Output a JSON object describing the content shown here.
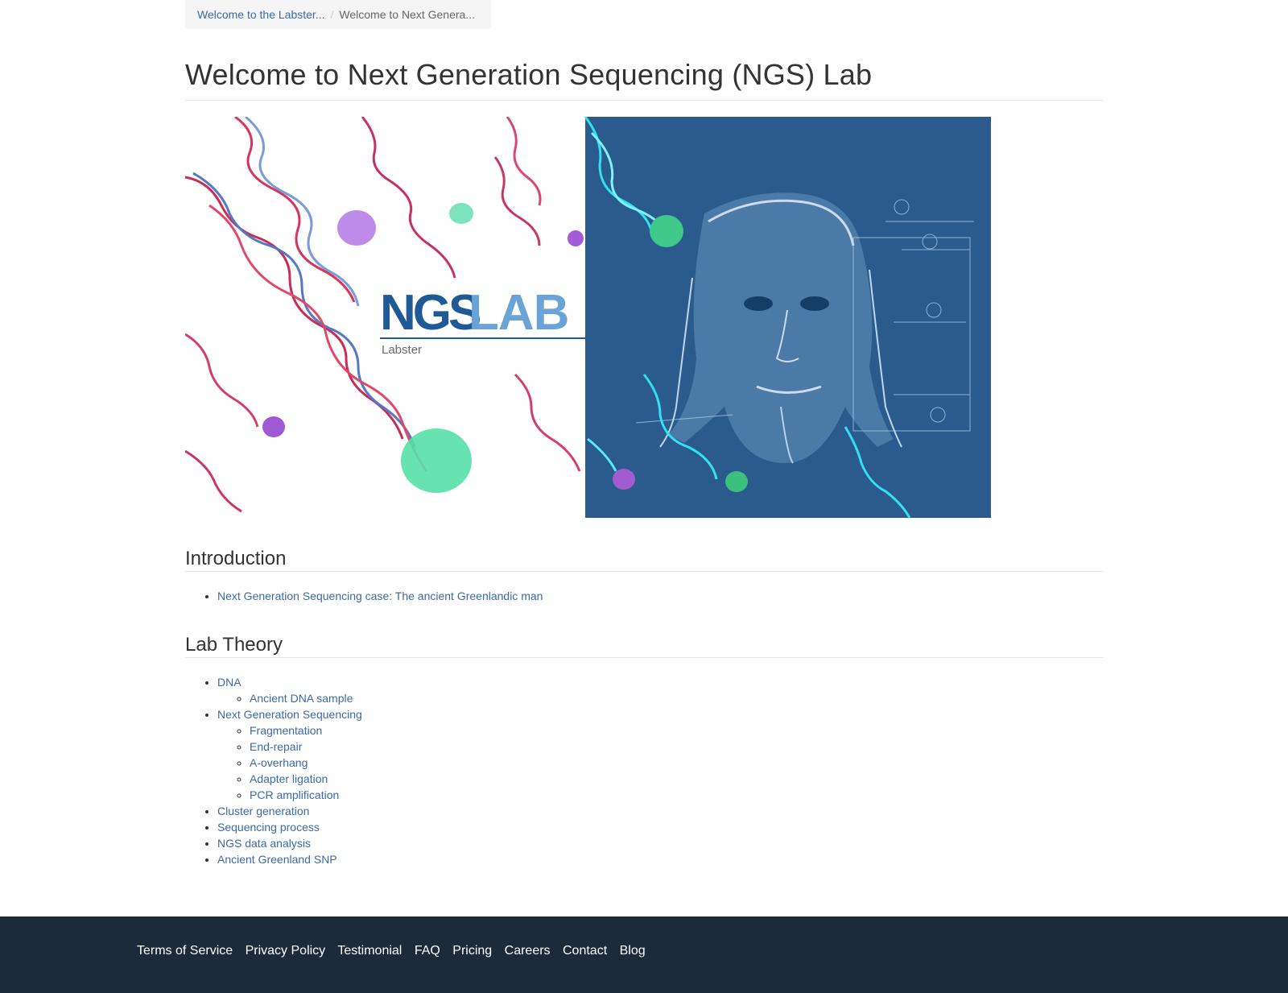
{
  "breadcrumb": {
    "items": [
      {
        "label": "Welcome to the Labster..."
      },
      {
        "label": "Welcome to Next Genera..."
      }
    ],
    "separator": "/"
  },
  "page": {
    "title": "Welcome to Next Generation Sequencing (NGS) Lab"
  },
  "banner": {
    "logo_ngs": "NGS",
    "logo_lab": "LAB",
    "logo_sub": "Labster",
    "left_bg": "#ffffff",
    "right_bg": "#2a5b8c"
  },
  "introduction": {
    "heading": "Introduction",
    "items": [
      {
        "label": "Next Generation Sequencing case: The ancient Greenlandic man"
      }
    ]
  },
  "lab_theory": {
    "heading": "Lab Theory",
    "items": [
      {
        "label": "DNA",
        "children": [
          {
            "label": "Ancient DNA sample"
          }
        ]
      },
      {
        "label": "Next Generation Sequencing",
        "children": [
          {
            "label": "Fragmentation"
          },
          {
            "label": "End-repair"
          },
          {
            "label": "A-overhang"
          },
          {
            "label": "Adapter ligation"
          },
          {
            "label": "PCR amplification"
          }
        ]
      },
      {
        "label": "Cluster generation"
      },
      {
        "label": "Sequencing process"
      },
      {
        "label": "NGS data analysis"
      },
      {
        "label": "Ancient Greenland SNP"
      }
    ]
  },
  "footer": {
    "links": [
      {
        "label": "Terms of Service"
      },
      {
        "label": "Privacy Policy"
      },
      {
        "label": "Testimonial"
      },
      {
        "label": "FAQ"
      },
      {
        "label": "Pricing"
      },
      {
        "label": "Careers"
      },
      {
        "label": "Contact"
      },
      {
        "label": "Blog"
      }
    ]
  },
  "colors": {
    "link": "#3b6aa5",
    "footer_bg": "#1c2a3a",
    "logo_dark": "#1f5a96",
    "logo_light": "#6aa3d6"
  }
}
